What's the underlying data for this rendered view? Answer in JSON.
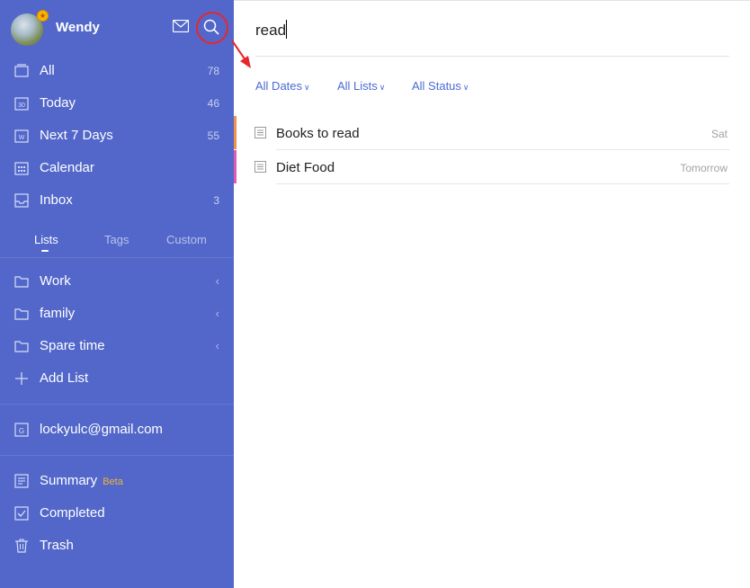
{
  "profile": {
    "name": "Wendy"
  },
  "nav": {
    "all": {
      "label": "All",
      "count": "78"
    },
    "today": {
      "label": "Today",
      "count": "46"
    },
    "next7": {
      "label": "Next 7 Days",
      "count": "55"
    },
    "calendar": {
      "label": "Calendar"
    },
    "inbox": {
      "label": "Inbox",
      "count": "3"
    }
  },
  "tabs": {
    "lists": "Lists",
    "tags": "Tags",
    "custom": "Custom"
  },
  "lists": [
    {
      "label": "Work"
    },
    {
      "label": "family"
    },
    {
      "label": "Spare time"
    }
  ],
  "add_list": "Add List",
  "account": "lockyulc@gmail.com",
  "bottom": {
    "summary": "Summary",
    "beta": "Beta",
    "completed": "Completed",
    "trash": "Trash"
  },
  "search": {
    "value": "read"
  },
  "filters": {
    "dates": "All Dates",
    "lists": "All Lists",
    "status": "All Status"
  },
  "tasks": [
    {
      "title": "Books to read",
      "due": "Sat",
      "color": "#f0904a"
    },
    {
      "title": "Diet Food",
      "due": "Tomorrow",
      "color": "#e05ab5"
    }
  ],
  "colors": {
    "sidebar": "#5267c9",
    "accent": "#4a6ad6",
    "highlight": "#e8262b"
  }
}
